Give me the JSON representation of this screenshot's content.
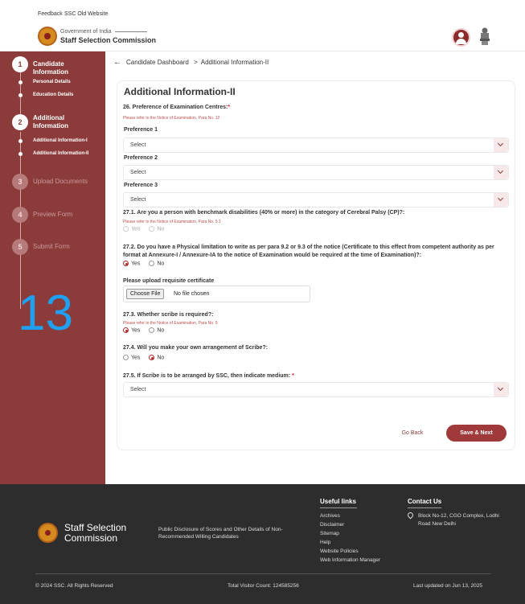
{
  "topbar": {
    "feedback": "Feedback",
    "old_site": "SSC Old Website"
  },
  "header": {
    "gov": "Government of India",
    "commission": "Staff Selection Commission"
  },
  "sidebar": {
    "steps": [
      {
        "num": "1",
        "label": "Candidate Information"
      },
      {
        "num": "2",
        "label": "Additional Information"
      },
      {
        "num": "3",
        "label": "Upload Documents"
      },
      {
        "num": "4",
        "label": "Preview Form"
      },
      {
        "num": "5",
        "label": "Submit Form"
      }
    ],
    "subs1": [
      "Personal Details",
      "Education Details"
    ],
    "subs2": [
      "Additional Information-I",
      "Additional Information-II"
    ],
    "overlay_number": "13"
  },
  "breadcrumb": {
    "back": "Candidate Dashboard",
    "sep": ">",
    "current": "Additional Information-II"
  },
  "form": {
    "title": "Additional Information-II",
    "q26": "26. Preference of Examination Centres:",
    "req": "*",
    "note26": "Please refer to the Notice of Examination, Para No. 12",
    "pref1": "Preference 1",
    "pref2": "Preference 2",
    "pref3": "Preference 3",
    "select_placeholder": "Select",
    "q271": "27.1. Are you a person with benchmark disabilities (40% or more) in the category of Cerebral Palsy (CP)?:",
    "note271": "Please refer to the Notice of Examination, Para No. 9.1",
    "q272": "27.2. Do you have a Physical limitation to write as per para 9.2 or 9.3 of the notice (Certificate to this effect from competent authority as per format at Annexure-I / Annexure-IA to the notice of Examination would be required at the time of Examination)?:",
    "upload_label": "Please upload requisite certificate",
    "choose_file": "Choose File",
    "no_file": "No file chosen",
    "q273": "27.3. Whether scribe is required?:",
    "note273": "Please refer to the Notice of Examination, Para No. 9",
    "q274": "27.4. Will you make your own arrangement of Scribe?:",
    "q275": "27.5. If Scribe is to be arranged by SSC, then indicate medium:",
    "yes": "Yes",
    "no": "No",
    "go_back": "Go Back",
    "save_next": "Save & Next"
  },
  "footer": {
    "brand_line1": "Staff Selection",
    "brand_line2": "Commission",
    "disclosure": "Public Disclosure of Scores and Other Details of Non-Recommended Willing Candidates",
    "useful_links_title": "Useful links",
    "links": [
      "Archives",
      "Disclaimer",
      "Sitemap",
      "Help",
      "Website Policies",
      "Web Information Manager"
    ],
    "contact_title": "Contact Us",
    "address": "Block No-12, CGO Complex, Lodhi Road New Delhi",
    "copyright": "© 2024 SSC. All Rights Reserved",
    "visitor": "Total Visitor Count: 124585256",
    "updated": "Last updated on Jun 13, 2025"
  },
  "colors": {
    "brand": "#8c3b3b",
    "accent": "#a03a3a",
    "overlay": "#1fa0f2",
    "footer": "#2d2d2d"
  }
}
